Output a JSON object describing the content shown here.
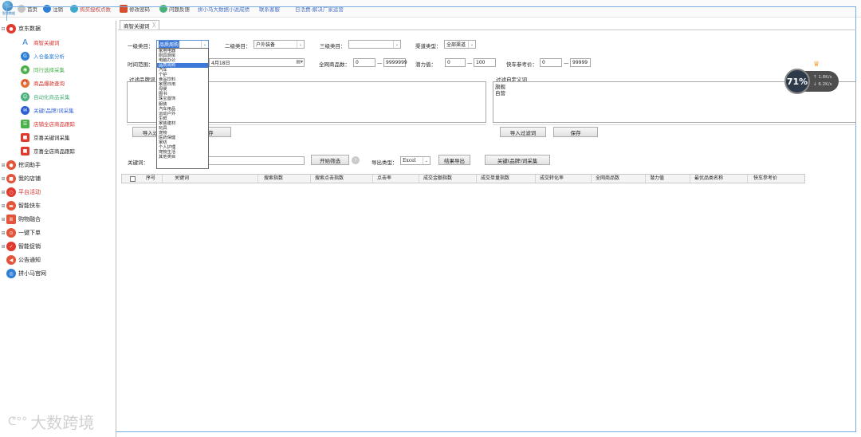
{
  "toolbar": {
    "logo_text": "智慧数据",
    "items": [
      {
        "label": "首页",
        "color": "#c4c4c4"
      },
      {
        "label": "注销",
        "color": "#2f7fd4"
      },
      {
        "label": "购买授权点数",
        "color": "#3fa8cf"
      },
      {
        "label": "修改密码",
        "color": "#d54f2e"
      },
      {
        "label": "问题反馈",
        "color": "#4ab07a"
      }
    ],
    "links": [
      "拼小马大数据小说成绩",
      "联系客服",
      "日活费-解决厂家运营"
    ]
  },
  "sidebar": {
    "groups": [
      {
        "label": "京东数据",
        "color": "#e03a2e",
        "expand": "⊟"
      },
      {
        "label": "挖词助手",
        "color": "#e2553a",
        "expand": "⊞"
      },
      {
        "label": "我的店铺",
        "color": "#e2553a",
        "expand": "⊞"
      },
      {
        "label": "平台活动",
        "color": "#e03a2e",
        "expand": "⊞"
      },
      {
        "label": "智能快车",
        "color": "#e2553a",
        "expand": "⊞"
      },
      {
        "label": "购物融合",
        "color": "#e2553a",
        "expand": "⊞"
      },
      {
        "label": "一键下单",
        "color": "#e2553a",
        "expand": "⊞"
      },
      {
        "label": "智能促销",
        "color": "#e03a2e",
        "expand": "⊞"
      },
      {
        "label": "公告通知",
        "color": "#e2553a",
        "expand": ""
      },
      {
        "label": "拼小马官网",
        "color": "#2f7fd4",
        "expand": ""
      }
    ],
    "sub_items": [
      {
        "label": "商智关键词",
        "color": "#e04a3a",
        "icon": "A",
        "text_color": "#d4302a"
      },
      {
        "label": "入仓备案分析",
        "color": "#2f7fd4",
        "icon": "G",
        "text_color": "#2f7fd4"
      },
      {
        "label": "同行选择采集",
        "color": "#4ab04a",
        "icon": "◉",
        "text_color": "#4ab04a"
      },
      {
        "label": "商品爆款查询",
        "color": "#e56f2e",
        "icon": "⏰",
        "text_color": "#d4302a"
      },
      {
        "label": "自动化商品采集",
        "color": "#4ab07a",
        "icon": "☺",
        "text_color": "#4ab07a"
      },
      {
        "label": "关键(品牌)词采集",
        "color": "#2f5fd4",
        "icon": "✉",
        "text_color": "#2f5fd4"
      },
      {
        "label": "店铺全店商品跟踪",
        "color": "#4ab04a",
        "icon": "☰",
        "text_color": "#d4302a"
      },
      {
        "label": "京喜关键词采集",
        "color": "#e03a2e",
        "icon": "■",
        "text_color": "#222222"
      },
      {
        "label": "京喜全店商品跟踪",
        "color": "#e03a2e",
        "icon": "■",
        "text_color": "#222222"
      }
    ]
  },
  "tab": {
    "label": "商智关键词",
    "close": "╳"
  },
  "filters": {
    "level1_label": "一级类目：",
    "level1_value": "品质周购",
    "level2_label": "二级类目：",
    "level2_value": "户外装备",
    "level3_label": "三级类目：",
    "level3_value": "",
    "channel_label": "渠道类型：",
    "channel_value": "全部渠道",
    "time_label": "时间范围：",
    "date_value": "4月18日",
    "net_goods_label": "全网商品数：",
    "net_goods_min": "0",
    "net_goods_max": "9999999",
    "range_sep": "—",
    "potential_label": "潜力值：",
    "potential_min": "0",
    "potential_max": "100",
    "price_label": "快车参考价：",
    "price_min": "0",
    "price_max": "99999"
  },
  "category_dropdown": {
    "options": [
      "家用电器",
      "厨具厨房",
      "电脑办公",
      "品质周购",
      "汽车",
      "个护",
      "食品饮料",
      "家居日用",
      "母婴",
      "图书",
      "珠宝首饰",
      "服装",
      "汽车用品",
      "运动户外",
      "生鲜",
      "家装建材",
      "玩具",
      "宠物",
      "医药保健",
      "家纺",
      "个人护理",
      "宠物生活",
      "其他类目"
    ],
    "selected_index": 3
  },
  "brand_filter": {
    "label": "过滤品牌词",
    "import_btn": "导入过滤词",
    "save_btn": "保存"
  },
  "custom_filter": {
    "label": "过滤自定义词",
    "lines": [
      "旗舰",
      "自营"
    ],
    "import_btn": "导入过滤词",
    "save_btn": "保存"
  },
  "search": {
    "keyword_label": "关键词：",
    "keyword_value": "",
    "start_btn": "开始筛选",
    "help": "?",
    "export_label": "导出类型：",
    "export_value": "Excel",
    "export_btn": "结果导出",
    "collect_btn": "关键(品牌)词采集"
  },
  "table": {
    "columns": [
      "序号",
      "关键词",
      "搜索指数",
      "搜索点击指数",
      "点击率",
      "成交金额指数",
      "成交单量指数",
      "成交转化率",
      "全网商品数",
      "潜力值",
      "最优品类名称",
      "快车参考价"
    ]
  },
  "widget": {
    "percent": "71%",
    "up": "↑ 1.8K/s",
    "down": "↓ 6.2K/s",
    "crown": "♛"
  },
  "watermark": "大数跨境"
}
